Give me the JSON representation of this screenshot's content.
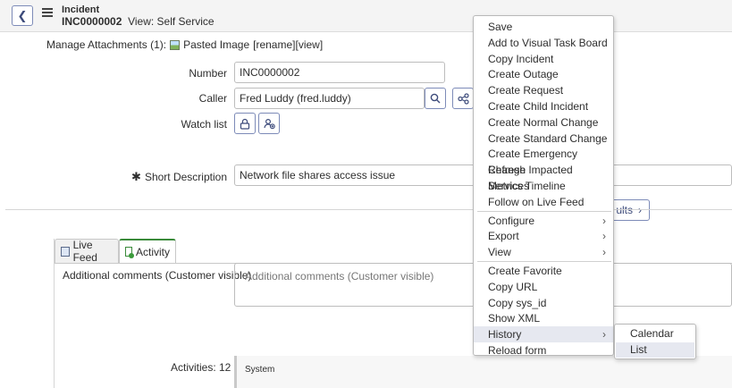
{
  "header": {
    "title": "Incident",
    "record_number": "INC0000002",
    "view_label": "View: Self Service"
  },
  "attachments": {
    "label": "Manage Attachments (1):",
    "file_name": "Pasted Image",
    "actions": "[rename][view]"
  },
  "form": {
    "number": {
      "label": "Number",
      "value": "INC0000002"
    },
    "caller": {
      "label": "Caller",
      "value": "Fred Luddy (fred.luddy)"
    },
    "watch_list": {
      "label": "Watch list"
    },
    "short_description": {
      "label": "Short Description",
      "required_mark": "✱",
      "value": "Network file shares access issue"
    }
  },
  "results_button": {
    "label": "ults"
  },
  "tabs": [
    {
      "label": "Live Feed"
    },
    {
      "label": "Activity"
    }
  ],
  "comments": {
    "label": "Additional comments (Customer visible)",
    "placeholder": "Additional comments (Customer visible)"
  },
  "activities": {
    "label": "Activities: 12",
    "first_entry": "System"
  },
  "context_menu": {
    "group1": [
      "Save",
      "Add to Visual Task Board",
      "Copy Incident",
      "Create Outage",
      "Create Request",
      "Create Child Incident",
      "Create Normal Change",
      "Create Standard Change",
      "Create Emergency Change",
      "Refresh Impacted Services",
      "Metrics Timeline",
      "Follow on Live Feed"
    ],
    "group2": [
      "Configure",
      "Export",
      "View"
    ],
    "group3": [
      "Create Favorite",
      "Copy URL",
      "Copy sys_id",
      "Show XML",
      "History",
      "Reload form"
    ],
    "highlighted": "History"
  },
  "history_submenu": {
    "items": [
      "Calendar",
      "List"
    ],
    "highlighted": "List"
  },
  "colors": {
    "accent": "#3c4a7a",
    "active_tab": "#3a8a3a",
    "menu_highlight": "#e6e8f0"
  }
}
